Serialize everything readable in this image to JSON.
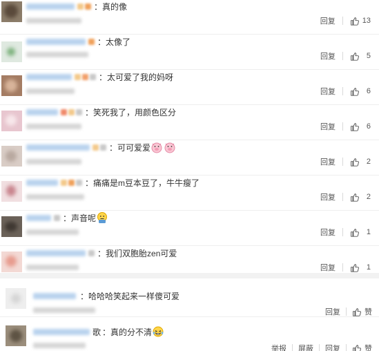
{
  "comments": [
    {
      "text": "真的像",
      "reply_label": "回复",
      "likes": "13",
      "emoji": ""
    },
    {
      "text": "太像了",
      "reply_label": "回复",
      "likes": "5",
      "emoji": ""
    },
    {
      "text": "太可爱了我的妈呀",
      "reply_label": "回复",
      "likes": "6",
      "emoji": ""
    },
    {
      "text": "笑死我了，用颜色区分",
      "reply_label": "回复",
      "likes": "6",
      "emoji": ""
    },
    {
      "text": "可可爱爱",
      "reply_label": "回复",
      "likes": "2",
      "emoji": "pig-face-emoji"
    },
    {
      "text": "痛痛是m豆本豆了，牛牛瘦了",
      "reply_label": "回复",
      "likes": "2",
      "emoji": ""
    },
    {
      "text": "声音呢",
      "reply_label": "回复",
      "likes": "1",
      "emoji": "thinking-face-emoji"
    },
    {
      "text": "我们双胞胎zen可爱",
      "reply_label": "回复",
      "likes": "1",
      "emoji": ""
    }
  ],
  "bottom_comments": [
    {
      "text": "哈哈哈笑起来一样傻可爱",
      "reply_label": "回复",
      "like_label": "赞",
      "emoji": ""
    },
    {
      "text": "真的分不清",
      "report_label": "举报",
      "block_label": "屏蔽",
      "reply_label": "回复",
      "like_label": "赞",
      "emoji": "laughing-tears-emoji",
      "nick_tail": "歌"
    }
  ],
  "colors": {
    "nickname_blur": "#b9d3ee",
    "text": "#333333",
    "action": "#555555",
    "separator": "#f2f2f2"
  }
}
